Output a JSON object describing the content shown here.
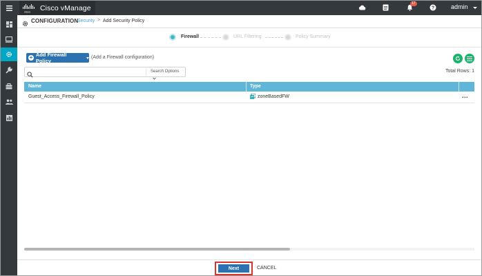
{
  "app": {
    "brand_sub": "cisco",
    "title": "Cisco vManage",
    "user": "admin",
    "notifications_count": "17"
  },
  "header": {
    "section": "CONFIGURATION",
    "breadcrumb_link": "Security",
    "breadcrumb_sep": ">",
    "breadcrumb_current": "Add Security Policy"
  },
  "wizard": {
    "steps": [
      {
        "label": "Firewall",
        "active": true
      },
      {
        "label": "URL Filtering",
        "active": false
      },
      {
        "label": "Policy Summary",
        "active": false
      }
    ]
  },
  "toolbar": {
    "add_label": "Add Firewall Policy",
    "add_hint": "(Add a Firewall configuration)",
    "search_placeholder": "",
    "search_options": "Search Options",
    "total_rows": "Total Rows: 1"
  },
  "table": {
    "headers": [
      "Name",
      "Type"
    ],
    "rows": [
      {
        "name": "Guest_Access_Firewall_Policy",
        "type": "zoneBasedFW",
        "more": "..."
      }
    ]
  },
  "footer": {
    "next": "Next",
    "cancel": "CANCEL"
  },
  "colors": {
    "accent": "#00a7c5",
    "primary": "#2c72b1",
    "header_row": "#5fb6d8",
    "topbar": "#34393d",
    "highlight": "#d9322d"
  },
  "icons": {
    "sidebar": [
      "dashboard-icon",
      "monitor-icon",
      "configuration-icon",
      "tools-icon",
      "maintenance-icon",
      "admin-icon",
      "analytics-icon"
    ],
    "topbar": [
      "cloud-icon",
      "tasks-icon",
      "bell-icon",
      "help-icon"
    ]
  }
}
